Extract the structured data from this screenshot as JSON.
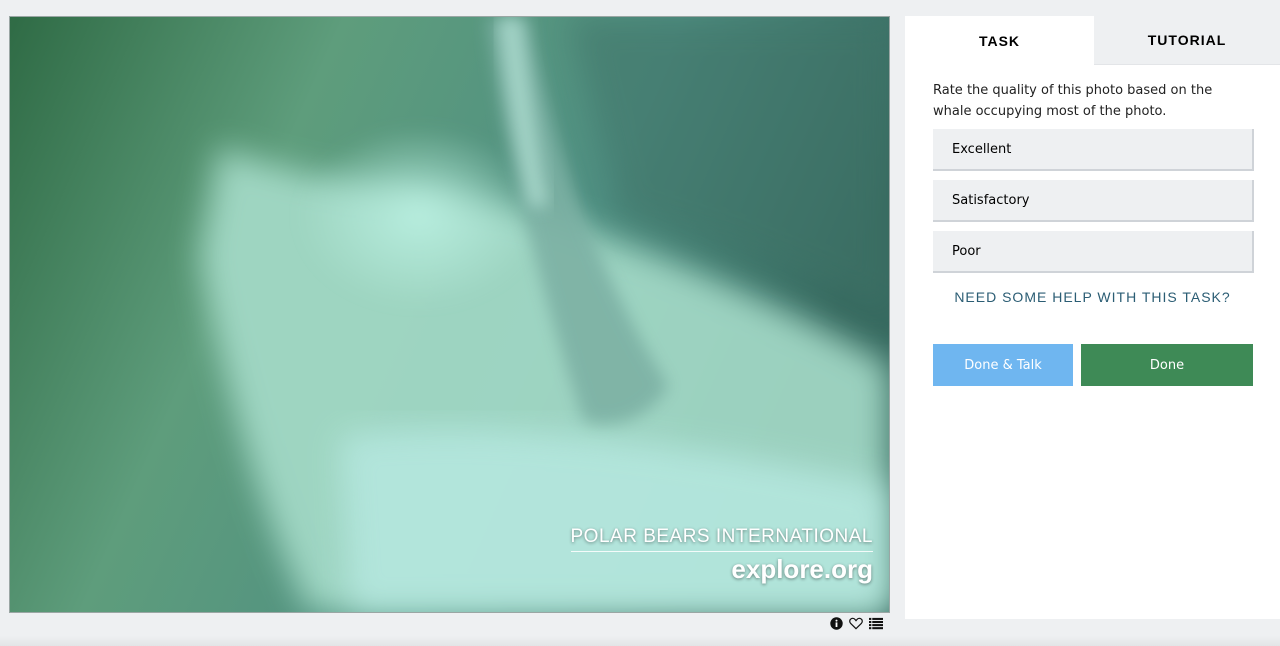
{
  "subject": {
    "watermark_line1": "POLAR BEARS INTERNATIONAL",
    "watermark_line2": "explore.org",
    "tools": [
      {
        "icon": "info-icon"
      },
      {
        "icon": "heart-icon"
      },
      {
        "icon": "collection-list-icon"
      }
    ]
  },
  "task_panel": {
    "tabs": [
      {
        "label": "TASK",
        "active": true
      },
      {
        "label": "TUTORIAL",
        "active": false
      }
    ],
    "question": "Rate the quality of this photo based on the whale occupying most of the photo.",
    "answers": [
      "Excellent",
      "Satisfactory",
      "Poor"
    ],
    "help_label": "NEED SOME HELP WITH THIS TASK?",
    "done_talk_label": "Done & Talk",
    "done_label": "Done"
  },
  "colors": {
    "done_talk": "#6fb6f0",
    "done": "#3e8a56",
    "help_link": "#2b5d74",
    "background": "#eef0f2"
  }
}
